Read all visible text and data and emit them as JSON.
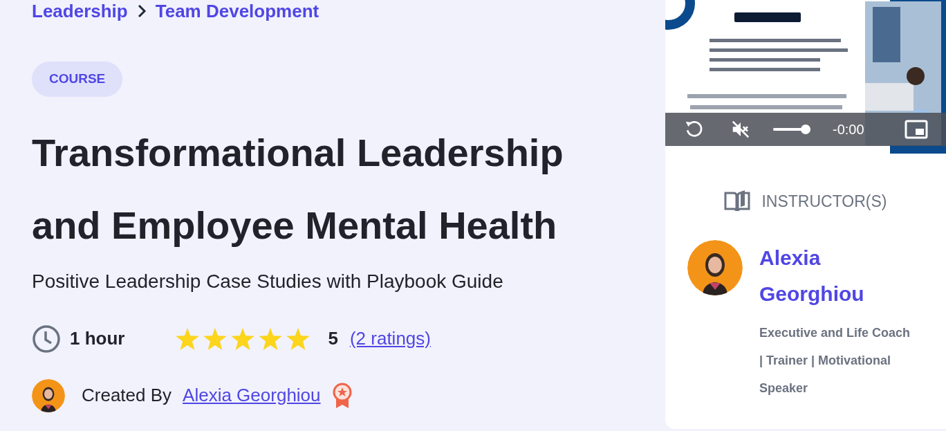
{
  "breadcrumb": [
    "Leadership",
    "Team Development"
  ],
  "badge": "COURSE",
  "title": "Transformational Leadership and Employee Mental Health",
  "subtitle": "Positive Leadership Case Studies with Playbook Guide",
  "duration": "1 hour",
  "rating": {
    "stars": 5,
    "score": "5",
    "count": "(2 ratings)"
  },
  "creator": {
    "label": "Created By",
    "name": "Alexia Georghiou"
  },
  "video": {
    "kind": "picture",
    "muted": true,
    "volume": {
      "level": 1
    },
    "time": "-0:00"
  },
  "instructors": {
    "heading": "INSTRUCTOR(S)",
    "items": [
      {
        "name": "Alexia Georghiou",
        "bio": "Executive and Life Coach | Trainer | Motivational Speaker"
      }
    ]
  }
}
